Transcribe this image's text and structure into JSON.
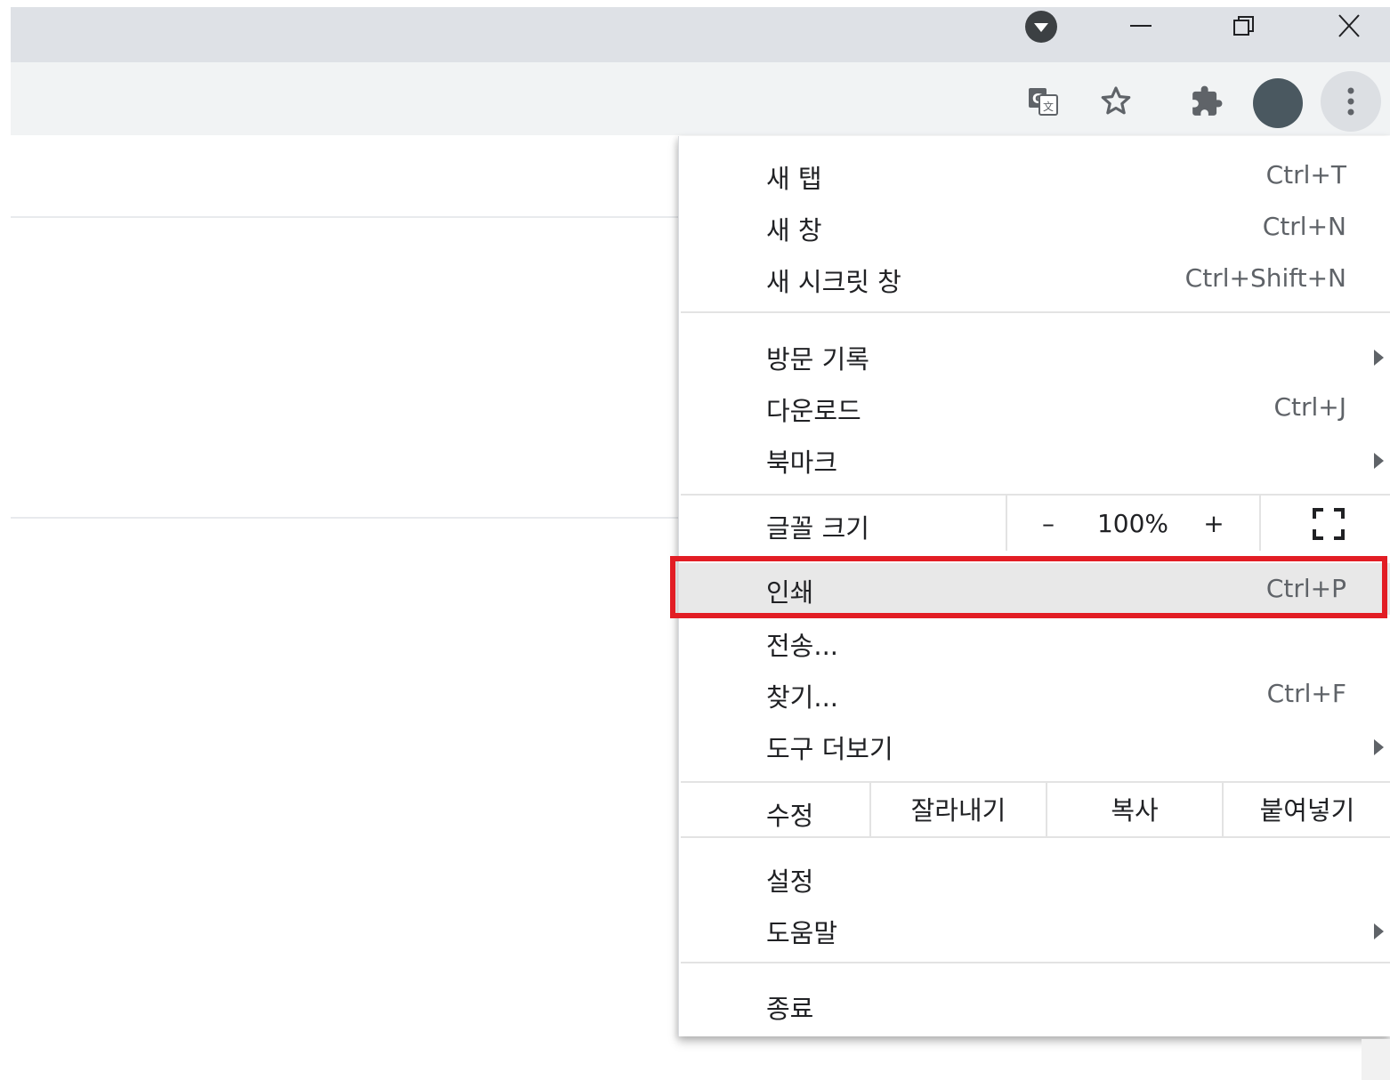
{
  "window": {
    "minimize_label": "–",
    "restore_label": "❐",
    "close_label": "✕"
  },
  "toolbar": {
    "icons": [
      "translate-icon",
      "star-icon",
      "extensions-icon",
      "profile-avatar",
      "more-icon"
    ]
  },
  "colors": {
    "titlebar": "#dee1e6",
    "toolbar": "#f1f3f4",
    "avatar": "#4a5860",
    "highlight_border": "#e21d24",
    "hover_row": "#e8e8e8"
  },
  "menu": {
    "new_tab": {
      "label": "새 탭",
      "shortcut": "Ctrl+T"
    },
    "new_window": {
      "label": "새 창",
      "shortcut": "Ctrl+N"
    },
    "new_incognito": {
      "label": "새 시크릿 창",
      "shortcut": "Ctrl+Shift+N"
    },
    "history": {
      "label": "방문 기록"
    },
    "downloads": {
      "label": "다운로드",
      "shortcut": "Ctrl+J"
    },
    "bookmarks": {
      "label": "북마크"
    },
    "zoom": {
      "label": "글꼴 크기",
      "minus": "–",
      "value": "100%",
      "plus": "+"
    },
    "print": {
      "label": "인쇄",
      "shortcut": "Ctrl+P"
    },
    "cast": {
      "label": "전송..."
    },
    "find": {
      "label": "찾기...",
      "shortcut": "Ctrl+F"
    },
    "more_tools": {
      "label": "도구 더보기"
    },
    "edit": {
      "label": "수정",
      "cut": "잘라내기",
      "copy": "복사",
      "paste": "붙여넣기"
    },
    "settings": {
      "label": "설정"
    },
    "help": {
      "label": "도움말"
    },
    "exit": {
      "label": "종료"
    }
  }
}
